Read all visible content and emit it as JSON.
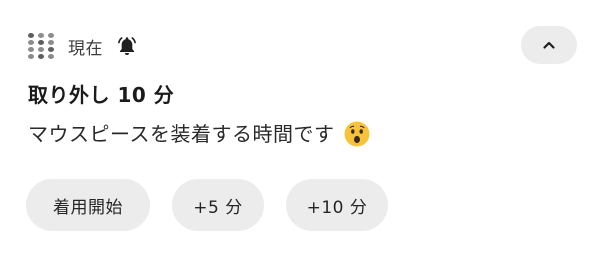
{
  "header": {
    "app_icon": "app-grid-icon",
    "time": "現在",
    "bell_icon": "bell-icon"
  },
  "controls": {
    "collapse_icon": "chevron-up-icon"
  },
  "notification": {
    "title": "取り外し 10 分",
    "body": "マウスピースを装着する時間です",
    "emoji_icon": "astonished-face-emoji"
  },
  "actions": [
    {
      "label": "着用開始"
    },
    {
      "label": "+5 分"
    },
    {
      "label": "+10 分"
    }
  ],
  "colors": {
    "background": "#ffffff",
    "button_bg": "#ececec",
    "text": "#1f1f1f",
    "emoji": "#f6c33b"
  }
}
